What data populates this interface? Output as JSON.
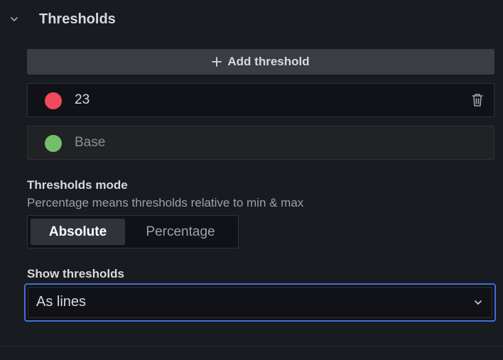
{
  "section": {
    "title": "Thresholds",
    "collapse_icon": "chevron-down-icon"
  },
  "add_threshold": {
    "label": "Add threshold",
    "icon": "plus-icon"
  },
  "thresholds": [
    {
      "value": "23",
      "color": "#f2495c",
      "deletable": true
    },
    {
      "value": "Base",
      "color": "#73bf69",
      "deletable": false
    }
  ],
  "thresholds_mode": {
    "label": "Thresholds mode",
    "description": "Percentage means thresholds relative to min & max",
    "options": [
      "Absolute",
      "Percentage"
    ],
    "selected": "Absolute"
  },
  "show_thresholds": {
    "label": "Show thresholds",
    "value": "As lines"
  },
  "colors": {
    "background": "#181b1f",
    "accent": "#3d71d9"
  }
}
